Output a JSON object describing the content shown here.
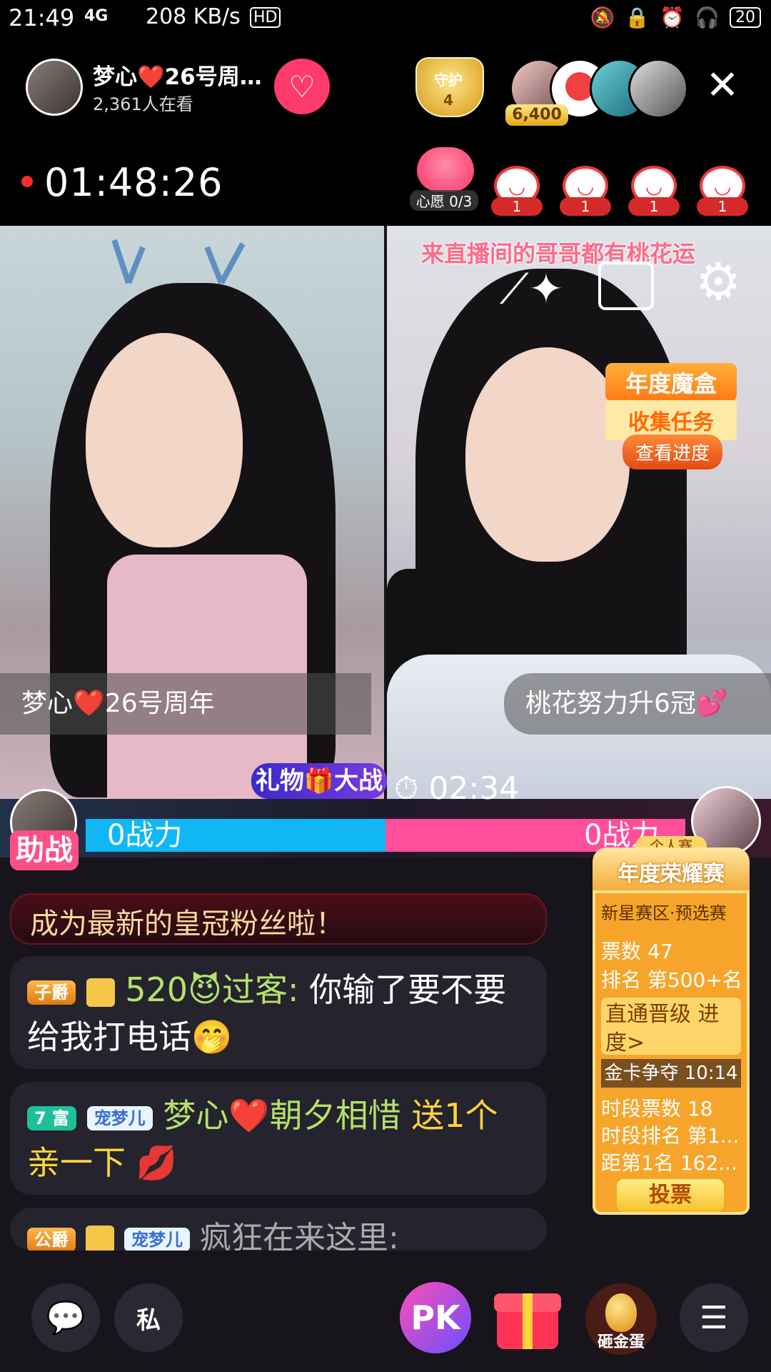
{
  "status_bar": {
    "time": "21:49",
    "network": "4G",
    "speed": "208 KB/s",
    "hd": "HD",
    "battery": "20"
  },
  "header": {
    "host_name": "梦心❤️26号周…",
    "viewers": "2,361人在看",
    "guard_title": "守护",
    "guard_count": "4",
    "top_fan_points": "6,400",
    "live_timer": "01:48:26",
    "wish_label": "心愿 0/3",
    "gift_counts": [
      "1",
      "1",
      "1",
      "1"
    ]
  },
  "stream": {
    "left_name": "梦心❤️26号周年",
    "right_name": "桃花努力升6冠💕",
    "banner": "来直播间的哥哥都有桃花运",
    "magic_box": {
      "title": "年度魔盒",
      "subtitle": "收集任务",
      "button": "查看进度"
    }
  },
  "battle": {
    "title": "礼物🎁大战",
    "timer": "02:34",
    "left_power": "0战力",
    "right_power": "0战力",
    "assist": "助战"
  },
  "chat": {
    "line1": "成为最新的皇冠粉丝啦！",
    "msg2": {
      "badge": "子爵",
      "user": "520😈过客:",
      "text": "你输了要不要给我打电话🤭"
    },
    "msg3": {
      "badge_rich": "7 富",
      "badge_pet": "宠梦儿",
      "user": "梦心❤️朝夕相惜",
      "gift": "送1个亲一下 💋"
    },
    "msg4": {
      "badge": "公爵",
      "badge_pet": "宠梦儿",
      "text": "疯狂在来这里:"
    }
  },
  "rank_card": {
    "tag": "个人赛",
    "title": "年度荣耀赛",
    "division": "新星赛区·预选赛",
    "votes": "票数 47",
    "rank": "排名 第500+名",
    "direct": "直通晋级",
    "progress": "进度>",
    "gold_card": "金卡争夺 10:14",
    "period_votes": "时段票数 18",
    "period_rank": "时段排名 第1...",
    "gap": "距第1名 162...",
    "vote_button": "投票"
  },
  "bottom_bar": {
    "private": "私",
    "pk": "PK",
    "egg": "砸金蛋"
  }
}
